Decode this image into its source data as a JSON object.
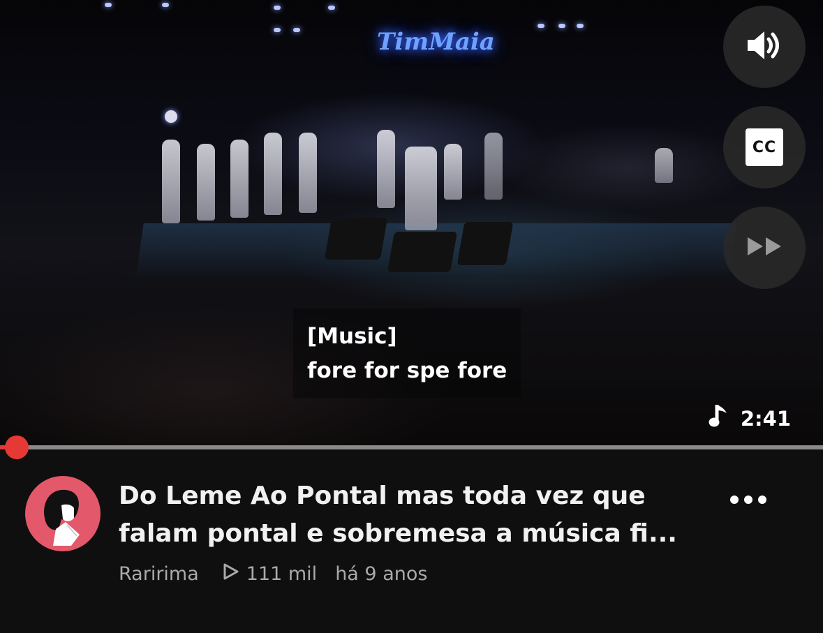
{
  "player": {
    "venue_sign": "TimMaia",
    "captions": {
      "line1": "[Music]",
      "line2": "fore for spe fore"
    },
    "duration": "2:41",
    "progress_fraction": 0.02,
    "controls": {
      "volume_icon": "speaker-volume-icon",
      "cc_label": "CC",
      "skip_icon": "fast-forward-icon"
    }
  },
  "video": {
    "title_line1": "Do Leme Ao Pontal mas toda vez que",
    "title_line2": "falam pontal e sobremesa a música fi...",
    "channel": "Raririma",
    "views": "111 mil",
    "age": "há 9 anos"
  },
  "colors": {
    "accent": "#e53935",
    "avatar_bg": "#e3586b",
    "background": "#0f0f0f",
    "meta_text": "#aaaaaa"
  }
}
